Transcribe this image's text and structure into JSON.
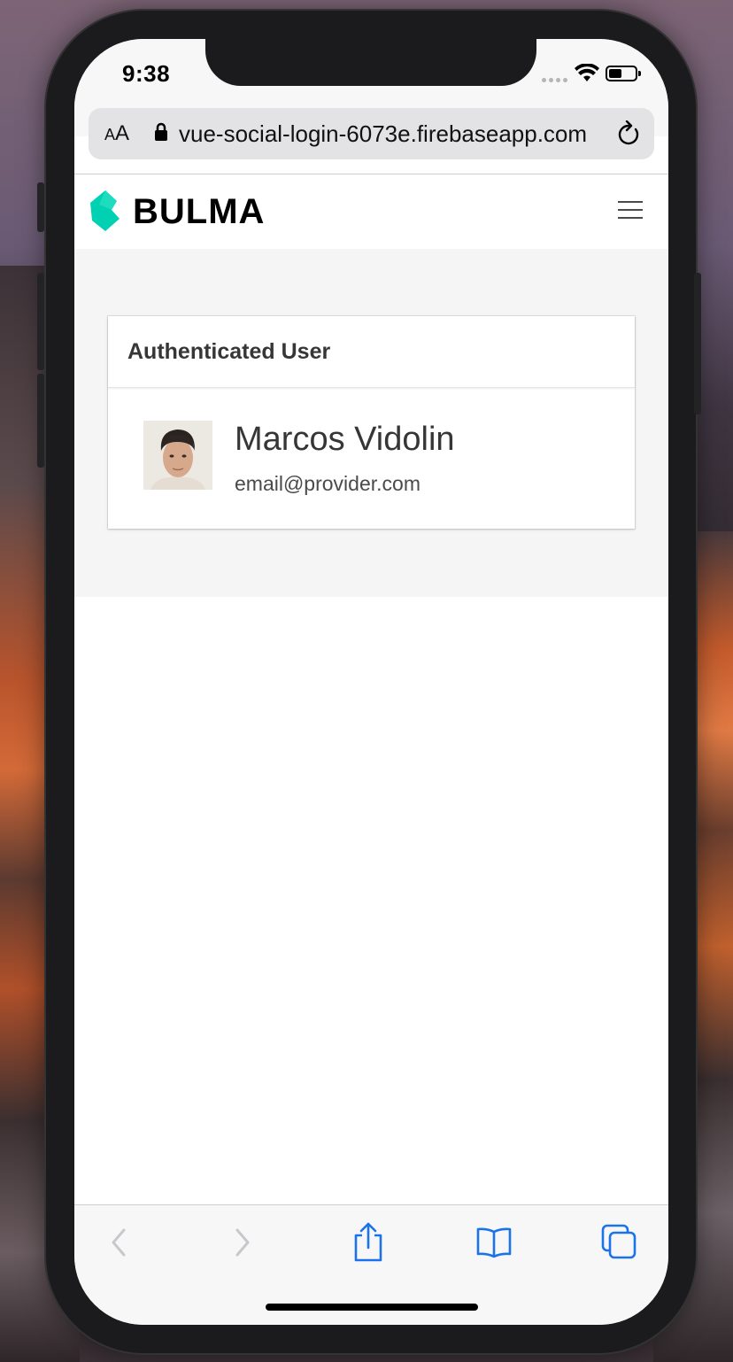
{
  "status_bar": {
    "time": "9:38"
  },
  "browser": {
    "text_size_button": "AA",
    "url": "vue-social-login-6073e.firebaseapp.com",
    "icons": [
      "lock-icon",
      "reload-icon"
    ]
  },
  "navbar": {
    "brand": "BULMA",
    "menu_icon": "hamburger-menu-icon"
  },
  "card": {
    "title": "Authenticated User",
    "user_name": "Marcos Vidolin",
    "user_email": "email@provider.com"
  },
  "toolbar": {
    "icons": [
      "back-arrow-icon",
      "forward-arrow-icon",
      "share-icon",
      "bookmarks-icon",
      "tabs-icon"
    ]
  },
  "colors": {
    "bulma_green": "#00d1b2",
    "ios_blue": "#1a73e8",
    "hero_bg": "#f5f5f5"
  }
}
